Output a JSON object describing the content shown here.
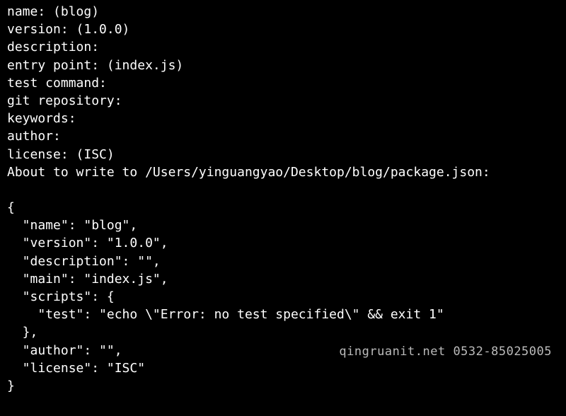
{
  "prompts": {
    "name": "name: (blog)",
    "version": "version: (1.0.0)",
    "description": "description:",
    "entry_point": "entry point: (index.js)",
    "test_command": "test command:",
    "git_repository": "git repository:",
    "keywords": "keywords:",
    "author": "author:",
    "license": "license: (ISC)",
    "about_to_write": "About to write to /Users/yinguangyao/Desktop/blog/package.json:"
  },
  "json_output": {
    "line_open": "{",
    "line_name": "  \"name\": \"blog\",",
    "line_version": "  \"version\": \"1.0.0\",",
    "line_description": "  \"description\": \"\",",
    "line_main": "  \"main\": \"index.js\",",
    "line_scripts_open": "  \"scripts\": {",
    "line_test": "    \"test\": \"echo \\\"Error: no test specified\\\" && exit 1\"",
    "line_scripts_close": "  },",
    "line_author": "  \"author\": \"\",",
    "line_license": "  \"license\": \"ISC\"",
    "line_close": "}"
  },
  "watermark": "qingruanit.net 0532-85025005"
}
